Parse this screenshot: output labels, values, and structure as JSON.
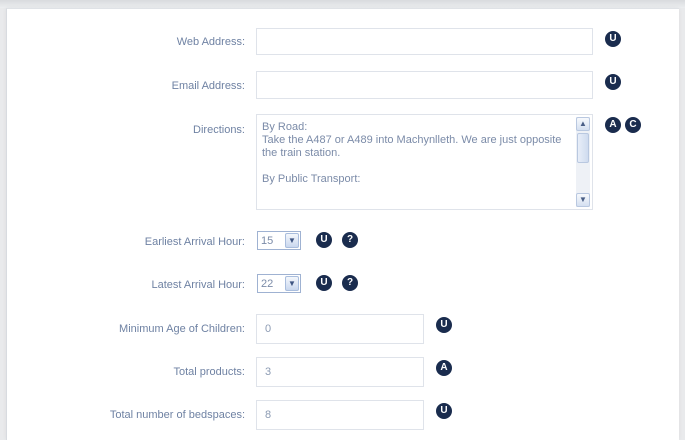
{
  "form": {
    "web_address": {
      "label": "Web Address:",
      "value": "",
      "badges": [
        "U"
      ]
    },
    "email_address": {
      "label": "Email Address:",
      "value": "",
      "badges": [
        "U"
      ]
    },
    "directions": {
      "label": "Directions:",
      "lines": [
        "By Road:",
        "Take the A487 or A489 into Machynlleth. We are just opposite the train station.",
        "",
        "By Public Transport:"
      ],
      "badges": [
        "A",
        "C"
      ]
    },
    "earliest_arrival": {
      "label": "Earliest Arrival Hour:",
      "value": "15",
      "badges": [
        "U",
        "?"
      ]
    },
    "latest_arrival": {
      "label": "Latest Arrival Hour:",
      "value": "22",
      "badges": [
        "U",
        "?"
      ]
    },
    "min_age_children": {
      "label": "Minimum Age of Children:",
      "value": "0",
      "badges": [
        "U"
      ]
    },
    "total_products": {
      "label": "Total products:",
      "value": "3",
      "badges": [
        "A"
      ]
    },
    "total_bedspaces": {
      "label": "Total number of bedspaces:",
      "value": "8",
      "badges": [
        "U"
      ]
    }
  },
  "icons": {
    "scroll_up": "▲",
    "scroll_down": "▼",
    "select_arrow": "▼"
  },
  "colors": {
    "label": "#6f82a3",
    "badge": "#1a2c4e",
    "field_border": "#dfe3ea"
  }
}
